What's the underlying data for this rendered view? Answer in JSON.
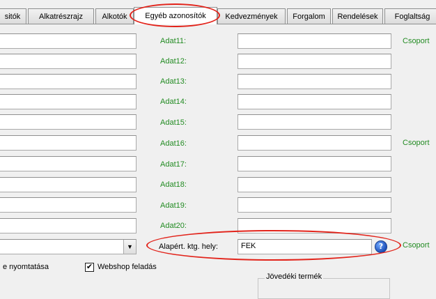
{
  "tabs": [
    {
      "label": "sitók"
    },
    {
      "label": "Alkatrészrajz"
    },
    {
      "label": "Alkotók"
    },
    {
      "label": "Egyéb azonosítók"
    },
    {
      "label": "Kedvezmények"
    },
    {
      "label": "Forgalom"
    },
    {
      "label": "Rendelések"
    },
    {
      "label": "Foglaltság"
    }
  ],
  "active_tab": "Egyéb azonosítók",
  "fields": [
    {
      "label": "Adat11:",
      "value": ""
    },
    {
      "label": "Adat12:",
      "value": ""
    },
    {
      "label": "Adat13:",
      "value": ""
    },
    {
      "label": "Adat14:",
      "value": ""
    },
    {
      "label": "Adat15:",
      "value": ""
    },
    {
      "label": "Adat16:",
      "value": ""
    },
    {
      "label": "Adat17:",
      "value": ""
    },
    {
      "label": "Adat18:",
      "value": ""
    },
    {
      "label": "Adat19:",
      "value": ""
    },
    {
      "label": "Adat20:",
      "value": ""
    }
  ],
  "csoport_labels": [
    "Csoport",
    "Csoport",
    "Csoport"
  ],
  "cost_center": {
    "label": "Alapért. ktg. hely:",
    "value": "FEK"
  },
  "bottom": {
    "print_label": "e nyomtatása",
    "webshop_label": "Webshop feladás",
    "webshop_checked": "✔",
    "group_title": "Jövedéki termék"
  },
  "colors": {
    "label_green": "#228b22",
    "annotation_red": "#e2231a"
  },
  "icons": {
    "help": "help-icon",
    "dropdown": "chevron-down-icon"
  }
}
